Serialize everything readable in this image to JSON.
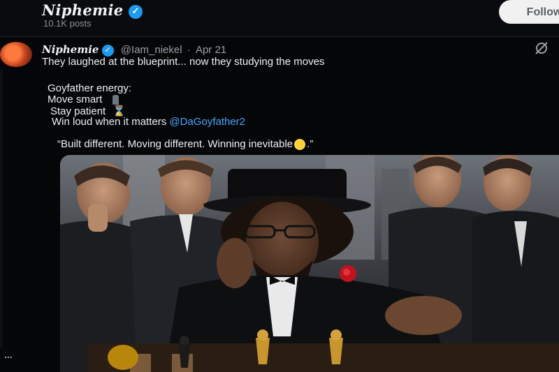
{
  "profile": {
    "name": "Niphemie",
    "posts_count": "10.1K posts",
    "follow_label": "Follow"
  },
  "tweet": {
    "author_name": "Niphemie",
    "handle": "@Iam_niekel",
    "separator": "·",
    "date": "Apr 21",
    "line1": "They laughed at the blueprint... now they studying the moves",
    "line2": "Goyfather energy:",
    "line3": "Move smart",
    "line4": "Stay patient",
    "line5": "Win loud when it matters",
    "mention": "@DaGoyfather2",
    "quote_before": "“Built different. Moving different. Winning inevitable",
    "quote_after": ".”",
    "more": "..."
  },
  "colors": {
    "accent": "#1d9bf0",
    "mention": "#3ea6ff",
    "background": "#050608"
  },
  "icons": {
    "verified": "verified-badge-icon",
    "grok": "grok-icon",
    "chess": "chess-pawn-emoji",
    "hourglass": "hourglass-emoji",
    "smile": "smiling-face-emoji"
  },
  "media": {
    "description_visible": false
  }
}
